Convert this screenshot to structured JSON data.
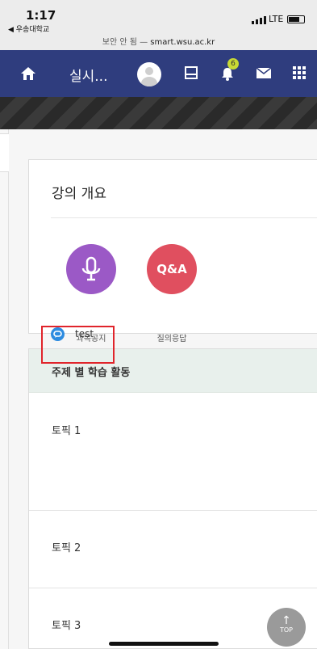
{
  "status": {
    "time": "1:17",
    "back_label": "◀ 우송대학교",
    "secure_label": "보안 안 됨 — ",
    "domain": "smart.wsu.ac.kr",
    "network": "LTE"
  },
  "nav": {
    "title": "실시...",
    "notification_count": "6",
    "icons": [
      "home-icon",
      "avatar",
      "contact-card-icon",
      "bell-icon",
      "mail-icon",
      "grid-menu-icon"
    ]
  },
  "overview": {
    "heading": "강의 개요",
    "notice_label": "과목공지",
    "qa_circle_text": "Q&A",
    "qa_label": "질의응답"
  },
  "weekly": {
    "heading": "주제 별 학습 활동",
    "topics": [
      {
        "label": "토픽 1"
      },
      {
        "label": "토픽 2"
      },
      {
        "label": "토픽 3"
      }
    ],
    "activity_label": "test"
  },
  "top_button": {
    "arrow": "↑",
    "label": "TOP"
  },
  "colors": {
    "nav_bg": "#2f3d7e",
    "notice_circle": "#9b59c6",
    "qa_circle": "#e04f5f",
    "highlight_box": "#e0242b",
    "activity_icon": "#2d8be0",
    "weekly_header_bg": "#e8f0ec"
  }
}
